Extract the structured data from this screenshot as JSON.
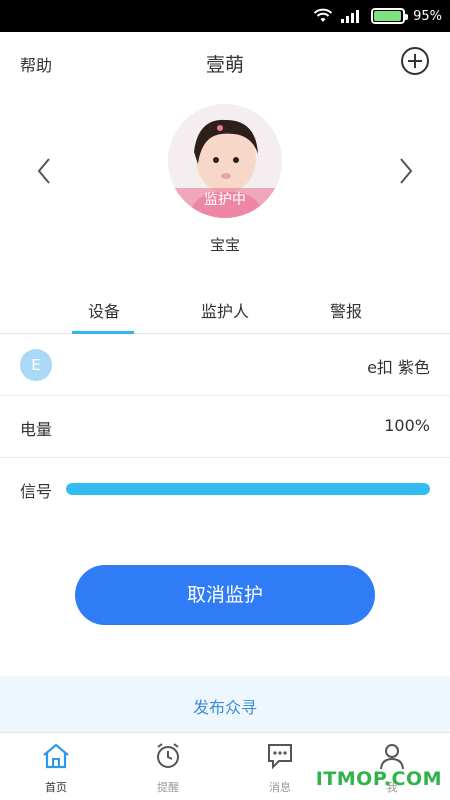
{
  "status_bar": {
    "battery_text": "95%",
    "battery_level": 0.95,
    "battery_color": "#7fe27f",
    "icons": [
      "wifi-icon",
      "signal-icon",
      "battery-icon"
    ]
  },
  "header": {
    "help_label": "帮助",
    "title": "壹萌",
    "add_icon": "plus-circle-icon"
  },
  "profile": {
    "avatar_status": "监护中",
    "name": "宝宝"
  },
  "tabs": [
    {
      "label": "设备",
      "active": true
    },
    {
      "label": "监护人",
      "active": false
    },
    {
      "label": "警报",
      "active": false
    }
  ],
  "device": {
    "badge_letter": "E",
    "name": "e扣 紫色",
    "battery_label": "电量",
    "battery_value": "100%",
    "signal_label": "信号",
    "signal_level": 1.0
  },
  "actions": {
    "cancel_label": "取消监护",
    "publish_label": "发布众寻"
  },
  "nav": [
    {
      "label": "首页",
      "icon": "home-icon",
      "active": true
    },
    {
      "label": "提醒",
      "icon": "alarm-clock-icon",
      "active": false
    },
    {
      "label": "消息",
      "icon": "chat-bubble-icon",
      "active": false
    },
    {
      "label": "我",
      "icon": "person-icon",
      "active": false
    }
  ],
  "watermark": "ITMOP.COM",
  "colors": {
    "accent_blue": "#2f7cf6",
    "tab_underline": "#33b5ef",
    "signal_fill": "#34baf2",
    "publish_text": "#3d8cd8"
  }
}
